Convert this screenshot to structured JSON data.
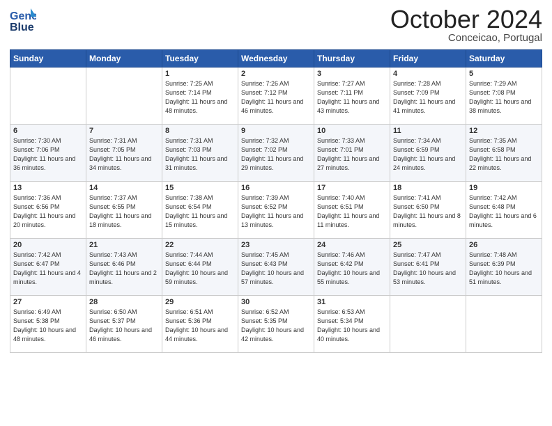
{
  "header": {
    "logo_line1": "General",
    "logo_line2": "Blue",
    "month": "October 2024",
    "location": "Conceicao, Portugal"
  },
  "days_of_week": [
    "Sunday",
    "Monday",
    "Tuesday",
    "Wednesday",
    "Thursday",
    "Friday",
    "Saturday"
  ],
  "weeks": [
    [
      {
        "day": "",
        "info": ""
      },
      {
        "day": "",
        "info": ""
      },
      {
        "day": "1",
        "info": "Sunrise: 7:25 AM\nSunset: 7:14 PM\nDaylight: 11 hours\nand 48 minutes."
      },
      {
        "day": "2",
        "info": "Sunrise: 7:26 AM\nSunset: 7:12 PM\nDaylight: 11 hours\nand 46 minutes."
      },
      {
        "day": "3",
        "info": "Sunrise: 7:27 AM\nSunset: 7:11 PM\nDaylight: 11 hours\nand 43 minutes."
      },
      {
        "day": "4",
        "info": "Sunrise: 7:28 AM\nSunset: 7:09 PM\nDaylight: 11 hours\nand 41 minutes."
      },
      {
        "day": "5",
        "info": "Sunrise: 7:29 AM\nSunset: 7:08 PM\nDaylight: 11 hours\nand 38 minutes."
      }
    ],
    [
      {
        "day": "6",
        "info": "Sunrise: 7:30 AM\nSunset: 7:06 PM\nDaylight: 11 hours\nand 36 minutes."
      },
      {
        "day": "7",
        "info": "Sunrise: 7:31 AM\nSunset: 7:05 PM\nDaylight: 11 hours\nand 34 minutes."
      },
      {
        "day": "8",
        "info": "Sunrise: 7:31 AM\nSunset: 7:03 PM\nDaylight: 11 hours\nand 31 minutes."
      },
      {
        "day": "9",
        "info": "Sunrise: 7:32 AM\nSunset: 7:02 PM\nDaylight: 11 hours\nand 29 minutes."
      },
      {
        "day": "10",
        "info": "Sunrise: 7:33 AM\nSunset: 7:01 PM\nDaylight: 11 hours\nand 27 minutes."
      },
      {
        "day": "11",
        "info": "Sunrise: 7:34 AM\nSunset: 6:59 PM\nDaylight: 11 hours\nand 24 minutes."
      },
      {
        "day": "12",
        "info": "Sunrise: 7:35 AM\nSunset: 6:58 PM\nDaylight: 11 hours\nand 22 minutes."
      }
    ],
    [
      {
        "day": "13",
        "info": "Sunrise: 7:36 AM\nSunset: 6:56 PM\nDaylight: 11 hours\nand 20 minutes."
      },
      {
        "day": "14",
        "info": "Sunrise: 7:37 AM\nSunset: 6:55 PM\nDaylight: 11 hours\nand 18 minutes."
      },
      {
        "day": "15",
        "info": "Sunrise: 7:38 AM\nSunset: 6:54 PM\nDaylight: 11 hours\nand 15 minutes."
      },
      {
        "day": "16",
        "info": "Sunrise: 7:39 AM\nSunset: 6:52 PM\nDaylight: 11 hours\nand 13 minutes."
      },
      {
        "day": "17",
        "info": "Sunrise: 7:40 AM\nSunset: 6:51 PM\nDaylight: 11 hours\nand 11 minutes."
      },
      {
        "day": "18",
        "info": "Sunrise: 7:41 AM\nSunset: 6:50 PM\nDaylight: 11 hours\nand 8 minutes."
      },
      {
        "day": "19",
        "info": "Sunrise: 7:42 AM\nSunset: 6:48 PM\nDaylight: 11 hours\nand 6 minutes."
      }
    ],
    [
      {
        "day": "20",
        "info": "Sunrise: 7:42 AM\nSunset: 6:47 PM\nDaylight: 11 hours\nand 4 minutes."
      },
      {
        "day": "21",
        "info": "Sunrise: 7:43 AM\nSunset: 6:46 PM\nDaylight: 11 hours\nand 2 minutes."
      },
      {
        "day": "22",
        "info": "Sunrise: 7:44 AM\nSunset: 6:44 PM\nDaylight: 10 hours\nand 59 minutes."
      },
      {
        "day": "23",
        "info": "Sunrise: 7:45 AM\nSunset: 6:43 PM\nDaylight: 10 hours\nand 57 minutes."
      },
      {
        "day": "24",
        "info": "Sunrise: 7:46 AM\nSunset: 6:42 PM\nDaylight: 10 hours\nand 55 minutes."
      },
      {
        "day": "25",
        "info": "Sunrise: 7:47 AM\nSunset: 6:41 PM\nDaylight: 10 hours\nand 53 minutes."
      },
      {
        "day": "26",
        "info": "Sunrise: 7:48 AM\nSunset: 6:39 PM\nDaylight: 10 hours\nand 51 minutes."
      }
    ],
    [
      {
        "day": "27",
        "info": "Sunrise: 6:49 AM\nSunset: 5:38 PM\nDaylight: 10 hours\nand 48 minutes."
      },
      {
        "day": "28",
        "info": "Sunrise: 6:50 AM\nSunset: 5:37 PM\nDaylight: 10 hours\nand 46 minutes."
      },
      {
        "day": "29",
        "info": "Sunrise: 6:51 AM\nSunset: 5:36 PM\nDaylight: 10 hours\nand 44 minutes."
      },
      {
        "day": "30",
        "info": "Sunrise: 6:52 AM\nSunset: 5:35 PM\nDaylight: 10 hours\nand 42 minutes."
      },
      {
        "day": "31",
        "info": "Sunrise: 6:53 AM\nSunset: 5:34 PM\nDaylight: 10 hours\nand 40 minutes."
      },
      {
        "day": "",
        "info": ""
      },
      {
        "day": "",
        "info": ""
      }
    ]
  ]
}
